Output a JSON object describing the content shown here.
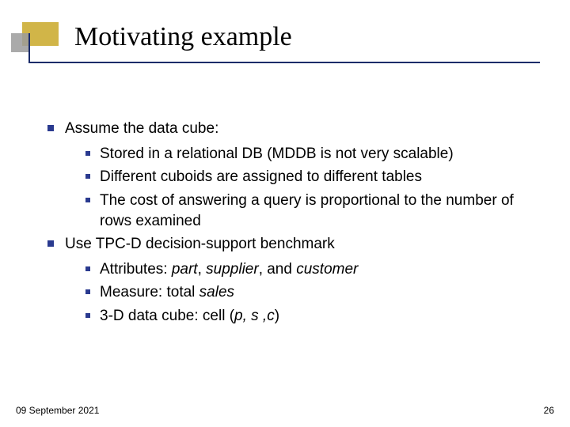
{
  "title": "Motivating example",
  "bullets": {
    "b0": "Assume the data cube:",
    "b0s": [
      "Stored in a relational DB (MDDB is not very scalable)",
      "Different cuboids are assigned to different tables",
      "The cost of answering a query is proportional to the number of rows examined"
    ],
    "b1": "Use TPC-D decision-support benchmark",
    "b1s_attr_pre": "Attributes: ",
    "b1s_attr_i1": "part",
    "b1s_attr_sep1": ", ",
    "b1s_attr_i2": "supplier",
    "b1s_attr_sep2": ", and ",
    "b1s_attr_i3": "customer",
    "b1s_meas_pre": "Measure: total ",
    "b1s_meas_i": "sales",
    "b1s_cube_pre": "3-D data cube: cell (",
    "b1s_cube_i": "p, s ,c",
    "b1s_cube_post": ")"
  },
  "footer": {
    "date": "09 September 2021",
    "page": "26"
  }
}
